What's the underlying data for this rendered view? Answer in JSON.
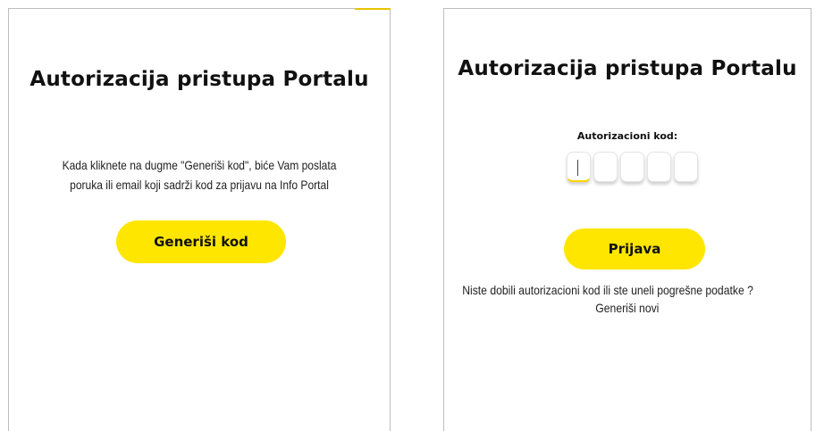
{
  "left_panel": {
    "title": "Autorizacija pristupa Portalu",
    "description_line1": "Kada kliknete na dugme \"Generiši kod\", biće Vam poslata",
    "description_line2": "poruka ili email koji sadrži kod za prijavu na Info Portal",
    "generate_button_label": "Generiši kod"
  },
  "right_panel": {
    "title": "Autorizacija pristupa Portalu",
    "code_label": "Autorizacioni kod:",
    "code_digits": [
      "",
      "",
      "",
      "",
      ""
    ],
    "login_button_label": "Prijava",
    "help_text": "Niste dobili autorizacioni kod ili ste uneli pogrešne podatke ?",
    "regenerate_link_label": "Generiši novi"
  },
  "colors": {
    "accent_yellow": "#ffe600",
    "text": "#111111",
    "panel_border": "#bdbdbd"
  }
}
